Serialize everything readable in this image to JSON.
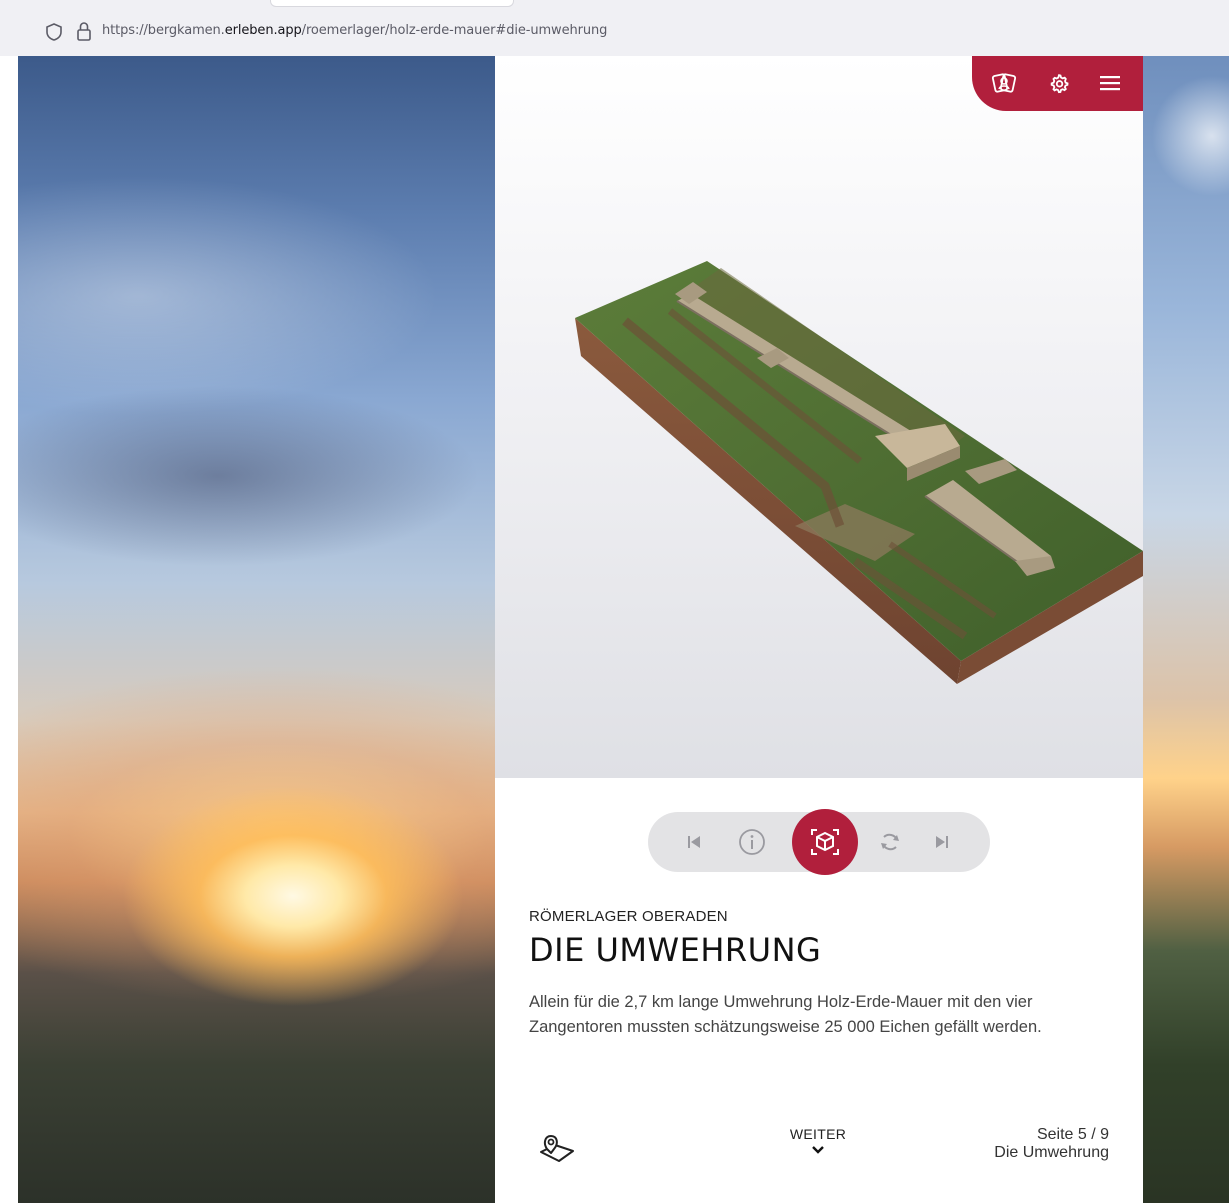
{
  "browser": {
    "url_prefix": "https://bergkamen.",
    "url_domain": "erleben.app",
    "url_path": "/roemerlager/holz-erde-mauer#die-umwehrung"
  },
  "topnav": {
    "icons": [
      "cards-icon",
      "gear-icon",
      "hamburger-menu-icon"
    ]
  },
  "controls": {
    "icons": [
      "skip-back-icon",
      "info-icon",
      "ar-cube-icon",
      "rotate-icon",
      "skip-forward-icon"
    ],
    "active": "ar-cube-icon"
  },
  "content": {
    "kicker": "RÖMERLAGER OBERADEN",
    "title": "DIE UMWEHRUNG",
    "description": "Allein für die 2,7 km lange Umwehrung Holz-Erde-Mauer mit den vier Zangentoren mussten schätzungsweise 25 000 Eichen gefällt werden."
  },
  "footer": {
    "map_icon": "map-pin-icon",
    "next_label": "WEITER",
    "page_label": "Seite 5 / 9",
    "page_title": "Die Umwehrung"
  },
  "colors": {
    "accent": "#b11f3c",
    "pill_bg": "#e3e3e5"
  }
}
